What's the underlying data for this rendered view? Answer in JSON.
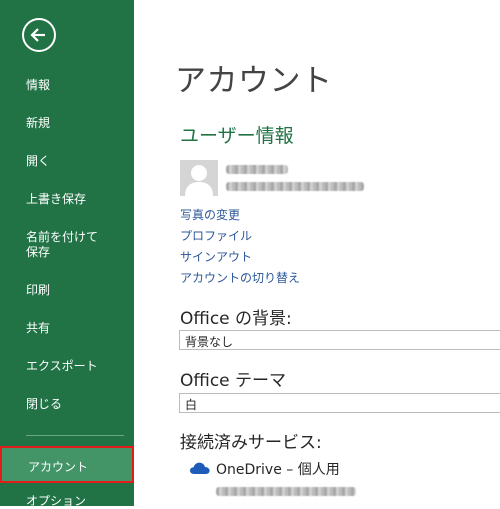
{
  "sidebar": {
    "items": [
      {
        "label": "情報"
      },
      {
        "label": "新規"
      },
      {
        "label": "開く"
      },
      {
        "label": "上書き保存"
      },
      {
        "label": "名前を付けて\n保存"
      },
      {
        "label": "印刷"
      },
      {
        "label": "共有"
      },
      {
        "label": "エクスポート"
      },
      {
        "label": "閉じる"
      }
    ],
    "active_label": "アカウント",
    "next_label": "オプション"
  },
  "main": {
    "title": "アカウント",
    "user_section": {
      "heading": "ユーザー情報",
      "links": [
        "写真の変更",
        "プロファイル",
        "サインアウト",
        "アカウントの切り替え"
      ]
    },
    "background": {
      "heading": "Office の背景:",
      "value": "背景なし"
    },
    "theme": {
      "heading": "Office テーマ",
      "value": "白"
    },
    "services": {
      "heading": "接続済みサービス:",
      "items": [
        {
          "label": "OneDrive – 個人用",
          "icon": "cloud-icon"
        }
      ]
    }
  },
  "colors": {
    "sidebar_bg": "#217346",
    "active_bg": "#439467",
    "highlight_border": "#e21b1b",
    "link": "#2b579a"
  }
}
